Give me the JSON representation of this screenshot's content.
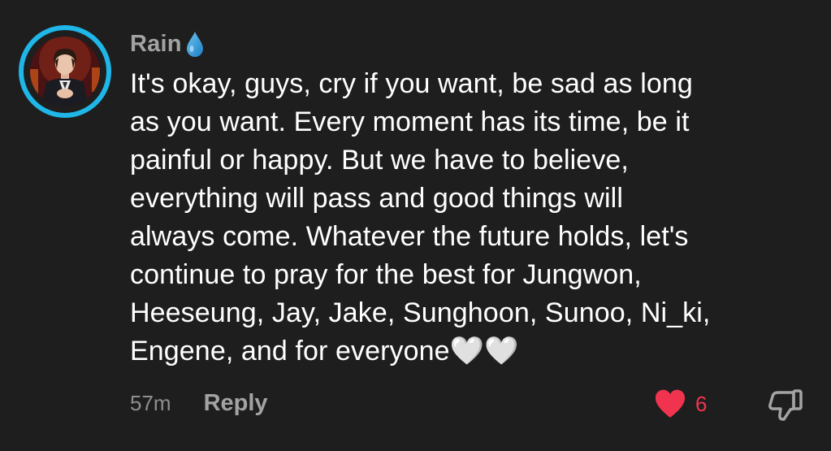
{
  "comment": {
    "username": "Rain",
    "username_emoji": "droplet-icon",
    "text": "It's okay, guys, cry if you want, be sad as long\nas you want. Every moment has its time, be it\npainful or happy. But we have to believe,\neverything will pass and good things will\nalways come. Whatever the future holds, let's\ncontinue to pray for the best for Jungwon,\nHeeseung, Jay, Jake, Sunghoon, Sunoo, Ni_ki,\nEngene, and for everyone🤍🤍",
    "timestamp": "57m",
    "reply_label": "Reply",
    "like_count": "6",
    "liked": true
  },
  "colors": {
    "background": "#1e1e1e",
    "avatar_ring": "#1fb6e8",
    "like": "#f0344f",
    "muted_text": "#a3a3a3"
  }
}
